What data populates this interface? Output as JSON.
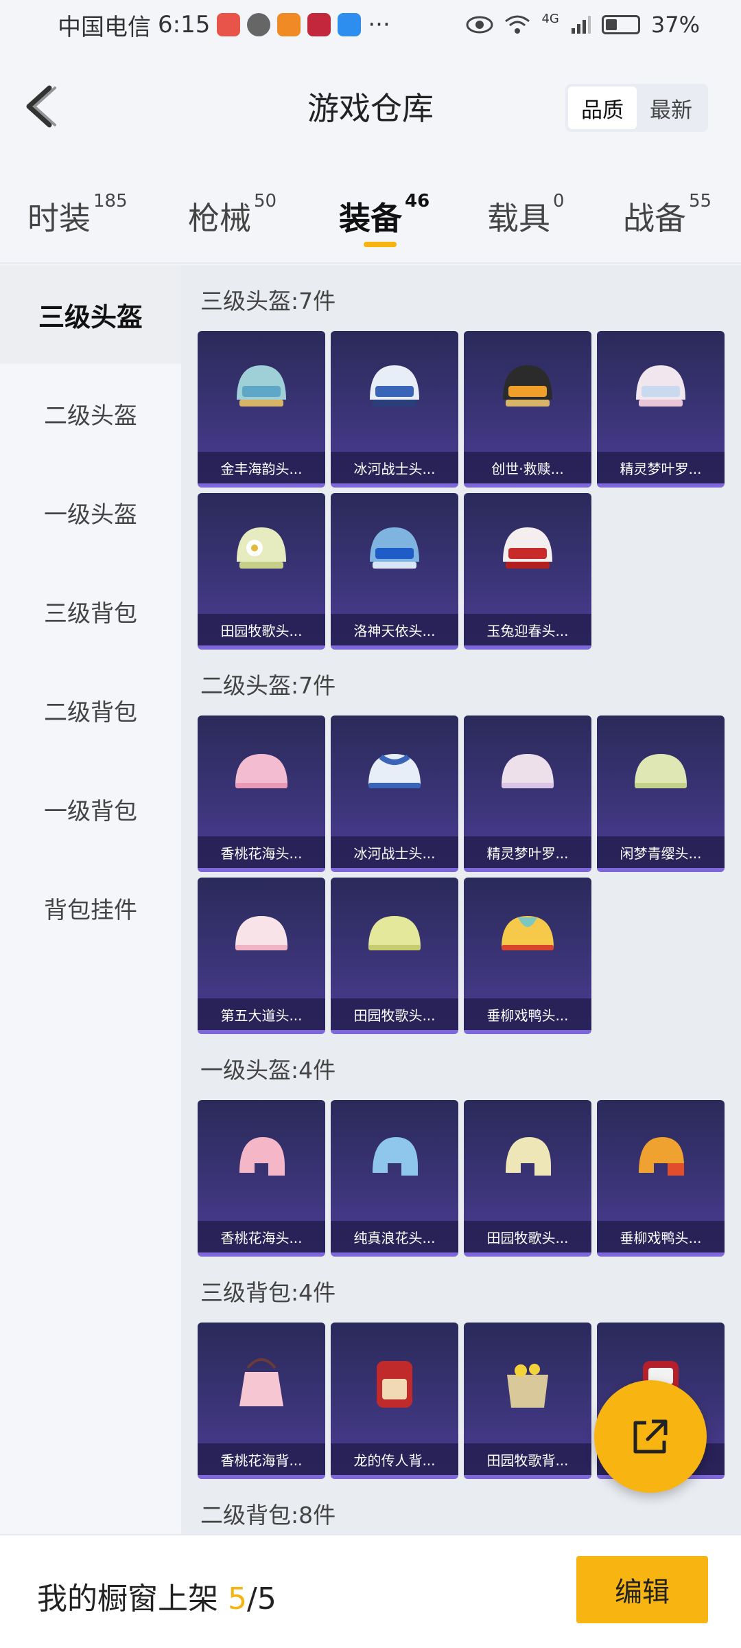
{
  "status_bar": {
    "carrier": "中国电信",
    "time": "6:15",
    "more": "···",
    "network": "4G",
    "battery": "37%"
  },
  "header": {
    "title": "游戏仓库",
    "sort_quality": "品质",
    "sort_newest": "最新"
  },
  "tabs": [
    {
      "label": "时装",
      "count": "185"
    },
    {
      "label": "枪械",
      "count": "50"
    },
    {
      "label": "装备",
      "count": "46"
    },
    {
      "label": "载具",
      "count": "0"
    },
    {
      "label": "战备",
      "count": "55"
    }
  ],
  "sidebar": {
    "items": [
      "三级头盔",
      "二级头盔",
      "一级头盔",
      "三级背包",
      "二级背包",
      "一级背包",
      "背包挂件"
    ]
  },
  "sections": [
    {
      "title": "三级头盔:7件",
      "items": [
        "金丰海韵头...",
        "冰河战士头...",
        "创世·救赎...",
        "精灵梦叶罗...",
        "田园牧歌头...",
        "洛神天依头...",
        "玉兔迎春头..."
      ]
    },
    {
      "title": "二级头盔:7件",
      "items": [
        "香桃花海头...",
        "冰河战士头...",
        "精灵梦叶罗...",
        "闲梦青缨头...",
        "第五大道头...",
        "田园牧歌头...",
        "垂柳戏鸭头..."
      ]
    },
    {
      "title": "一级头盔:4件",
      "items": [
        "香桃花海头...",
        "纯真浪花头...",
        "田园牧歌头...",
        "垂柳戏鸭头..."
      ]
    },
    {
      "title": "三级背包:4件",
      "items": [
        "香桃花海背...",
        "龙的传人背...",
        "田园牧歌背...",
        ""
      ]
    },
    {
      "title": "二级背包:8件",
      "items": []
    }
  ],
  "bottom": {
    "window_prefix": "我的橱窗上架",
    "window_count": "5",
    "window_total": "/5",
    "edit_label": "编辑"
  },
  "colors": {
    "accent": "#f8b512",
    "card_bg": "#3b3477",
    "card_border": "#7d67d9"
  },
  "icons": [
    "back-arrow-icon",
    "eye-icon",
    "wifi-icon",
    "signal-icon",
    "battery-icon",
    "share-external-icon"
  ]
}
